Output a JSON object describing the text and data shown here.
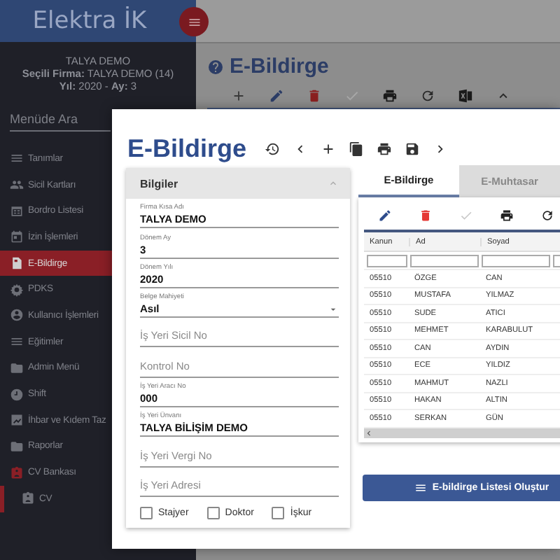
{
  "app": {
    "logo": "Elektra İK"
  },
  "sidebar": {
    "company": "TALYA DEMO",
    "firm_line": "**Seçili Firma:** TALYA DEMO (14)",
    "period_line": "**Yıl:** 2020 - **Ay:** 3",
    "search": {
      "placeholder": "Menüde Ara"
    },
    "items": [
      {
        "label": "Tanımlar",
        "selected": false,
        "expanded": false
      },
      {
        "label": "Sicil Kartları",
        "selected": false,
        "expanded": false
      },
      {
        "label": "Bordro Listesi",
        "selected": false,
        "expanded": false
      },
      {
        "label": "İzin İşlemleri",
        "selected": false,
        "expanded": false
      },
      {
        "label": "E-Bildirge",
        "selected": true,
        "expanded": false
      },
      {
        "label": "PDKS",
        "selected": false,
        "expanded": false
      },
      {
        "label": "Kullanıcı İşlemleri",
        "selected": false,
        "expanded": false
      },
      {
        "label": "Eğitimler",
        "selected": false,
        "expanded": false
      },
      {
        "label": "Admin Menü",
        "selected": false,
        "expanded": false
      },
      {
        "label": "Shift",
        "selected": false,
        "expanded": false
      },
      {
        "label": "İhbar ve Kıdem Taz",
        "selected": false,
        "expanded": false
      },
      {
        "label": "Raporlar",
        "selected": false,
        "expanded": false
      },
      {
        "label": "CV Bankası",
        "selected": false,
        "expanded": true,
        "children": [
          {
            "label": "CV",
            "selected": false
          }
        ]
      }
    ]
  },
  "page": {
    "title": "E-Bildirge"
  },
  "modal": {
    "title": "E-Bildirge",
    "info_panel": {
      "title": "Bilgiler",
      "expanded": true,
      "fields": [
        {
          "kind": "text",
          "label": "Firma Kısa Adı",
          "value": "TALYA DEMO"
        },
        {
          "kind": "text",
          "label": "Dönem Ay",
          "value": "3"
        },
        {
          "kind": "text",
          "label": "Dönem Yılı",
          "value": "2020"
        },
        {
          "kind": "select",
          "label": "Belge Mahiyeti",
          "value": "Asıl"
        },
        {
          "kind": "text",
          "placeholder": "İş Yeri Sicil No"
        },
        {
          "kind": "text",
          "placeholder": "Kontrol No"
        },
        {
          "kind": "text",
          "label": "İş Yeri Aracı No",
          "value": "000"
        },
        {
          "kind": "text",
          "label": "İş Yeri Ünvanı",
          "value": "TALYA BİLİŞİM DEMO"
        },
        {
          "kind": "text",
          "placeholder": "İş Yeri Vergi No"
        },
        {
          "kind": "text",
          "placeholder": "İş Yeri Adresi"
        }
      ],
      "checkboxes": [
        {
          "label": "Stajyer",
          "checked": false
        },
        {
          "label": "Doktor",
          "checked": false
        },
        {
          "label": "İşkur",
          "checked": false
        }
      ]
    },
    "tabs": [
      {
        "label": "E-Bildirge",
        "selected": true
      },
      {
        "label": "E-Muhtasar",
        "selected": false
      }
    ],
    "table": {
      "columns": [
        "Kanun",
        "Ad",
        "Soyad"
      ],
      "rows": [
        [
          "05510",
          "ÖZGE",
          "CAN"
        ],
        [
          "05510",
          "MUSTAFA",
          "YILMAZ"
        ],
        [
          "05510",
          "SUDE",
          "ATICI"
        ],
        [
          "05510",
          "MEHMET",
          "KARABULUT"
        ],
        [
          "05510",
          "CAN",
          "AYDIN"
        ],
        [
          "05510",
          "ECE",
          "YILDIZ"
        ],
        [
          "05510",
          "MAHMUT",
          "NAZLI"
        ],
        [
          "05510",
          "HAKAN",
          "ALTIN"
        ],
        [
          "05510",
          "SERKAN",
          "GÜN"
        ]
      ]
    },
    "create_button": "E-bildirge Listesi Oluştur"
  }
}
